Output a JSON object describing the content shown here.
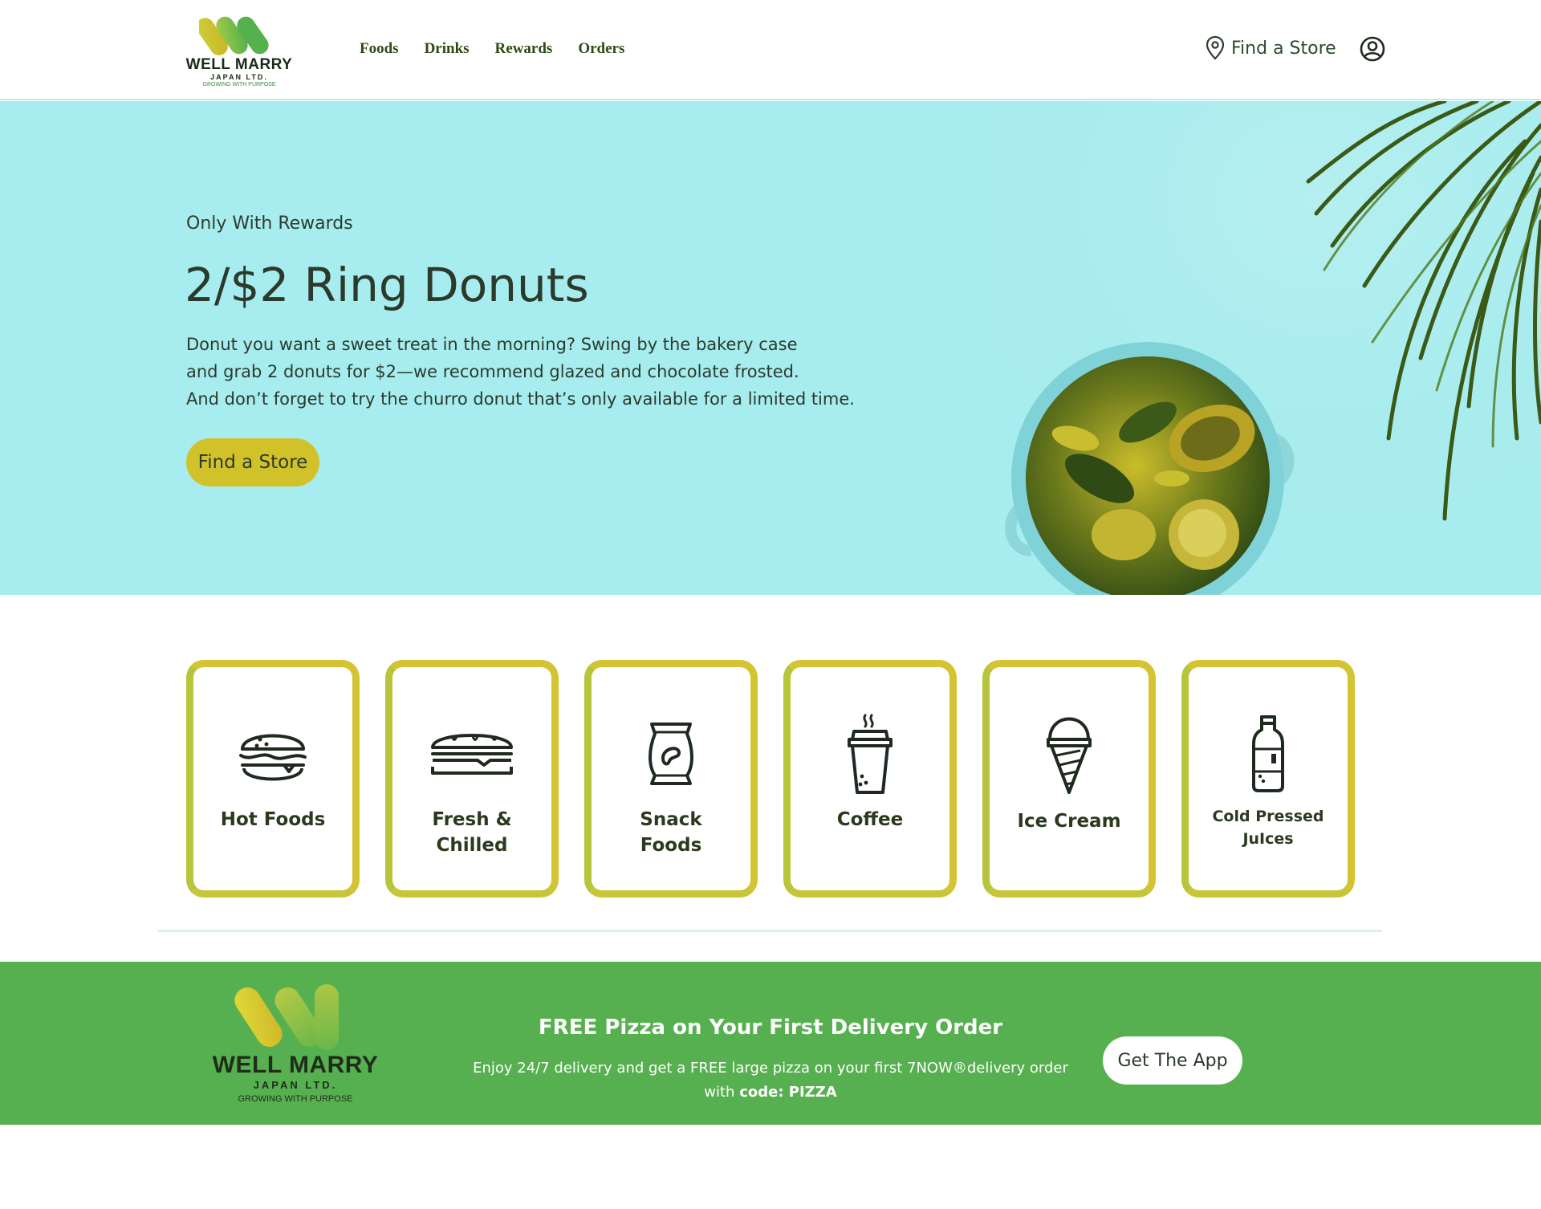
{
  "brand": {
    "name": "WELL MARRY",
    "sub": "JAPAN LTD.",
    "tagline": "GROWING WITH PURPOSE"
  },
  "nav": {
    "items": [
      "Foods",
      "Drinks",
      "Rewards",
      "Orders"
    ],
    "find_store": "Find a Store"
  },
  "hero": {
    "kicker": "Only With Rewards",
    "title": "2/$2 Ring Donuts",
    "body": [
      "Donut you want a sweet treat in the morning? Swing by the bakery case",
      "and grab 2 donuts for $2—we recommend glazed and chocolate frosted.",
      "And don’t forget to try the churro donut that’s only available for a limited time."
    ],
    "button": "Find a Store"
  },
  "categories": [
    {
      "label1": "Hot Foods",
      "label2": "",
      "icon": "burger-icon"
    },
    {
      "label1": "Fresh &",
      "label2": "Chilled",
      "icon": "sandwich-icon"
    },
    {
      "label1": "Snack",
      "label2": "Foods",
      "icon": "chips-bag-icon"
    },
    {
      "label1": "Coffee",
      "label2": "",
      "icon": "coffee-cup-icon"
    },
    {
      "label1": "Ice Cream",
      "label2": "",
      "icon": "ice-cream-cone-icon"
    },
    {
      "label1": "Cold Pressed",
      "label2": "JuIces",
      "icon": "juice-bottle-icon"
    }
  ],
  "promo": {
    "title": "FREE Pizza on Your First Delivery Order",
    "text_line1": "Enjoy 24/7 delivery and get a FREE large pizza on your first 7NOW®delivery order",
    "text_with": "with",
    "text_code": "code: PIZZA",
    "button": "Get The App"
  },
  "colors": {
    "hero_bg": "#a7ecee",
    "accent_yellow": "#d2c22a",
    "promo_green": "#57b04f",
    "text_dark": "#2b3a2b"
  }
}
